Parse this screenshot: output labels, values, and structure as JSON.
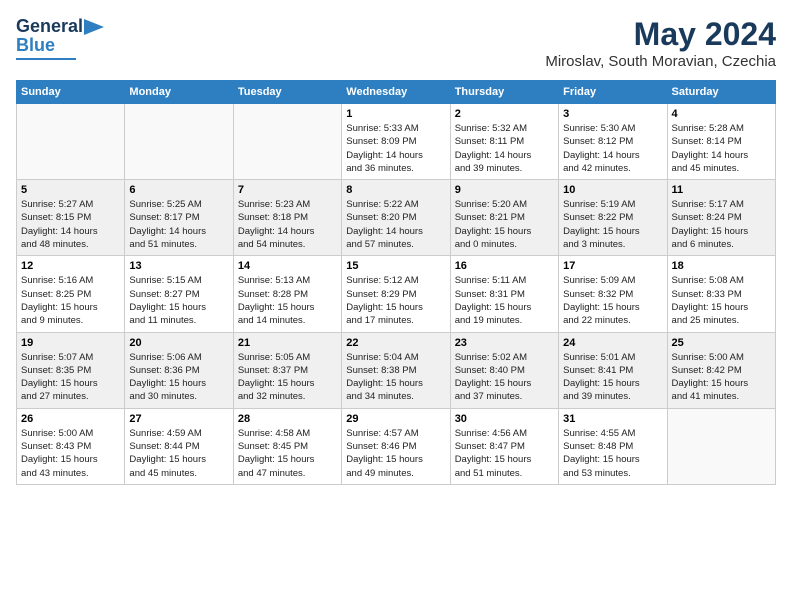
{
  "logo": {
    "line1": "General",
    "line2": "Blue"
  },
  "title": {
    "month_year": "May 2024",
    "location": "Miroslav, South Moravian, Czechia"
  },
  "weekdays": [
    "Sunday",
    "Monday",
    "Tuesday",
    "Wednesday",
    "Thursday",
    "Friday",
    "Saturday"
  ],
  "weeks": [
    [
      {
        "day": "",
        "info": ""
      },
      {
        "day": "",
        "info": ""
      },
      {
        "day": "",
        "info": ""
      },
      {
        "day": "1",
        "info": "Sunrise: 5:33 AM\nSunset: 8:09 PM\nDaylight: 14 hours\nand 36 minutes."
      },
      {
        "day": "2",
        "info": "Sunrise: 5:32 AM\nSunset: 8:11 PM\nDaylight: 14 hours\nand 39 minutes."
      },
      {
        "day": "3",
        "info": "Sunrise: 5:30 AM\nSunset: 8:12 PM\nDaylight: 14 hours\nand 42 minutes."
      },
      {
        "day": "4",
        "info": "Sunrise: 5:28 AM\nSunset: 8:14 PM\nDaylight: 14 hours\nand 45 minutes."
      }
    ],
    [
      {
        "day": "5",
        "info": "Sunrise: 5:27 AM\nSunset: 8:15 PM\nDaylight: 14 hours\nand 48 minutes."
      },
      {
        "day": "6",
        "info": "Sunrise: 5:25 AM\nSunset: 8:17 PM\nDaylight: 14 hours\nand 51 minutes."
      },
      {
        "day": "7",
        "info": "Sunrise: 5:23 AM\nSunset: 8:18 PM\nDaylight: 14 hours\nand 54 minutes."
      },
      {
        "day": "8",
        "info": "Sunrise: 5:22 AM\nSunset: 8:20 PM\nDaylight: 14 hours\nand 57 minutes."
      },
      {
        "day": "9",
        "info": "Sunrise: 5:20 AM\nSunset: 8:21 PM\nDaylight: 15 hours\nand 0 minutes."
      },
      {
        "day": "10",
        "info": "Sunrise: 5:19 AM\nSunset: 8:22 PM\nDaylight: 15 hours\nand 3 minutes."
      },
      {
        "day": "11",
        "info": "Sunrise: 5:17 AM\nSunset: 8:24 PM\nDaylight: 15 hours\nand 6 minutes."
      }
    ],
    [
      {
        "day": "12",
        "info": "Sunrise: 5:16 AM\nSunset: 8:25 PM\nDaylight: 15 hours\nand 9 minutes."
      },
      {
        "day": "13",
        "info": "Sunrise: 5:15 AM\nSunset: 8:27 PM\nDaylight: 15 hours\nand 11 minutes."
      },
      {
        "day": "14",
        "info": "Sunrise: 5:13 AM\nSunset: 8:28 PM\nDaylight: 15 hours\nand 14 minutes."
      },
      {
        "day": "15",
        "info": "Sunrise: 5:12 AM\nSunset: 8:29 PM\nDaylight: 15 hours\nand 17 minutes."
      },
      {
        "day": "16",
        "info": "Sunrise: 5:11 AM\nSunset: 8:31 PM\nDaylight: 15 hours\nand 19 minutes."
      },
      {
        "day": "17",
        "info": "Sunrise: 5:09 AM\nSunset: 8:32 PM\nDaylight: 15 hours\nand 22 minutes."
      },
      {
        "day": "18",
        "info": "Sunrise: 5:08 AM\nSunset: 8:33 PM\nDaylight: 15 hours\nand 25 minutes."
      }
    ],
    [
      {
        "day": "19",
        "info": "Sunrise: 5:07 AM\nSunset: 8:35 PM\nDaylight: 15 hours\nand 27 minutes."
      },
      {
        "day": "20",
        "info": "Sunrise: 5:06 AM\nSunset: 8:36 PM\nDaylight: 15 hours\nand 30 minutes."
      },
      {
        "day": "21",
        "info": "Sunrise: 5:05 AM\nSunset: 8:37 PM\nDaylight: 15 hours\nand 32 minutes."
      },
      {
        "day": "22",
        "info": "Sunrise: 5:04 AM\nSunset: 8:38 PM\nDaylight: 15 hours\nand 34 minutes."
      },
      {
        "day": "23",
        "info": "Sunrise: 5:02 AM\nSunset: 8:40 PM\nDaylight: 15 hours\nand 37 minutes."
      },
      {
        "day": "24",
        "info": "Sunrise: 5:01 AM\nSunset: 8:41 PM\nDaylight: 15 hours\nand 39 minutes."
      },
      {
        "day": "25",
        "info": "Sunrise: 5:00 AM\nSunset: 8:42 PM\nDaylight: 15 hours\nand 41 minutes."
      }
    ],
    [
      {
        "day": "26",
        "info": "Sunrise: 5:00 AM\nSunset: 8:43 PM\nDaylight: 15 hours\nand 43 minutes."
      },
      {
        "day": "27",
        "info": "Sunrise: 4:59 AM\nSunset: 8:44 PM\nDaylight: 15 hours\nand 45 minutes."
      },
      {
        "day": "28",
        "info": "Sunrise: 4:58 AM\nSunset: 8:45 PM\nDaylight: 15 hours\nand 47 minutes."
      },
      {
        "day": "29",
        "info": "Sunrise: 4:57 AM\nSunset: 8:46 PM\nDaylight: 15 hours\nand 49 minutes."
      },
      {
        "day": "30",
        "info": "Sunrise: 4:56 AM\nSunset: 8:47 PM\nDaylight: 15 hours\nand 51 minutes."
      },
      {
        "day": "31",
        "info": "Sunrise: 4:55 AM\nSunset: 8:48 PM\nDaylight: 15 hours\nand 53 minutes."
      },
      {
        "day": "",
        "info": ""
      }
    ]
  ]
}
